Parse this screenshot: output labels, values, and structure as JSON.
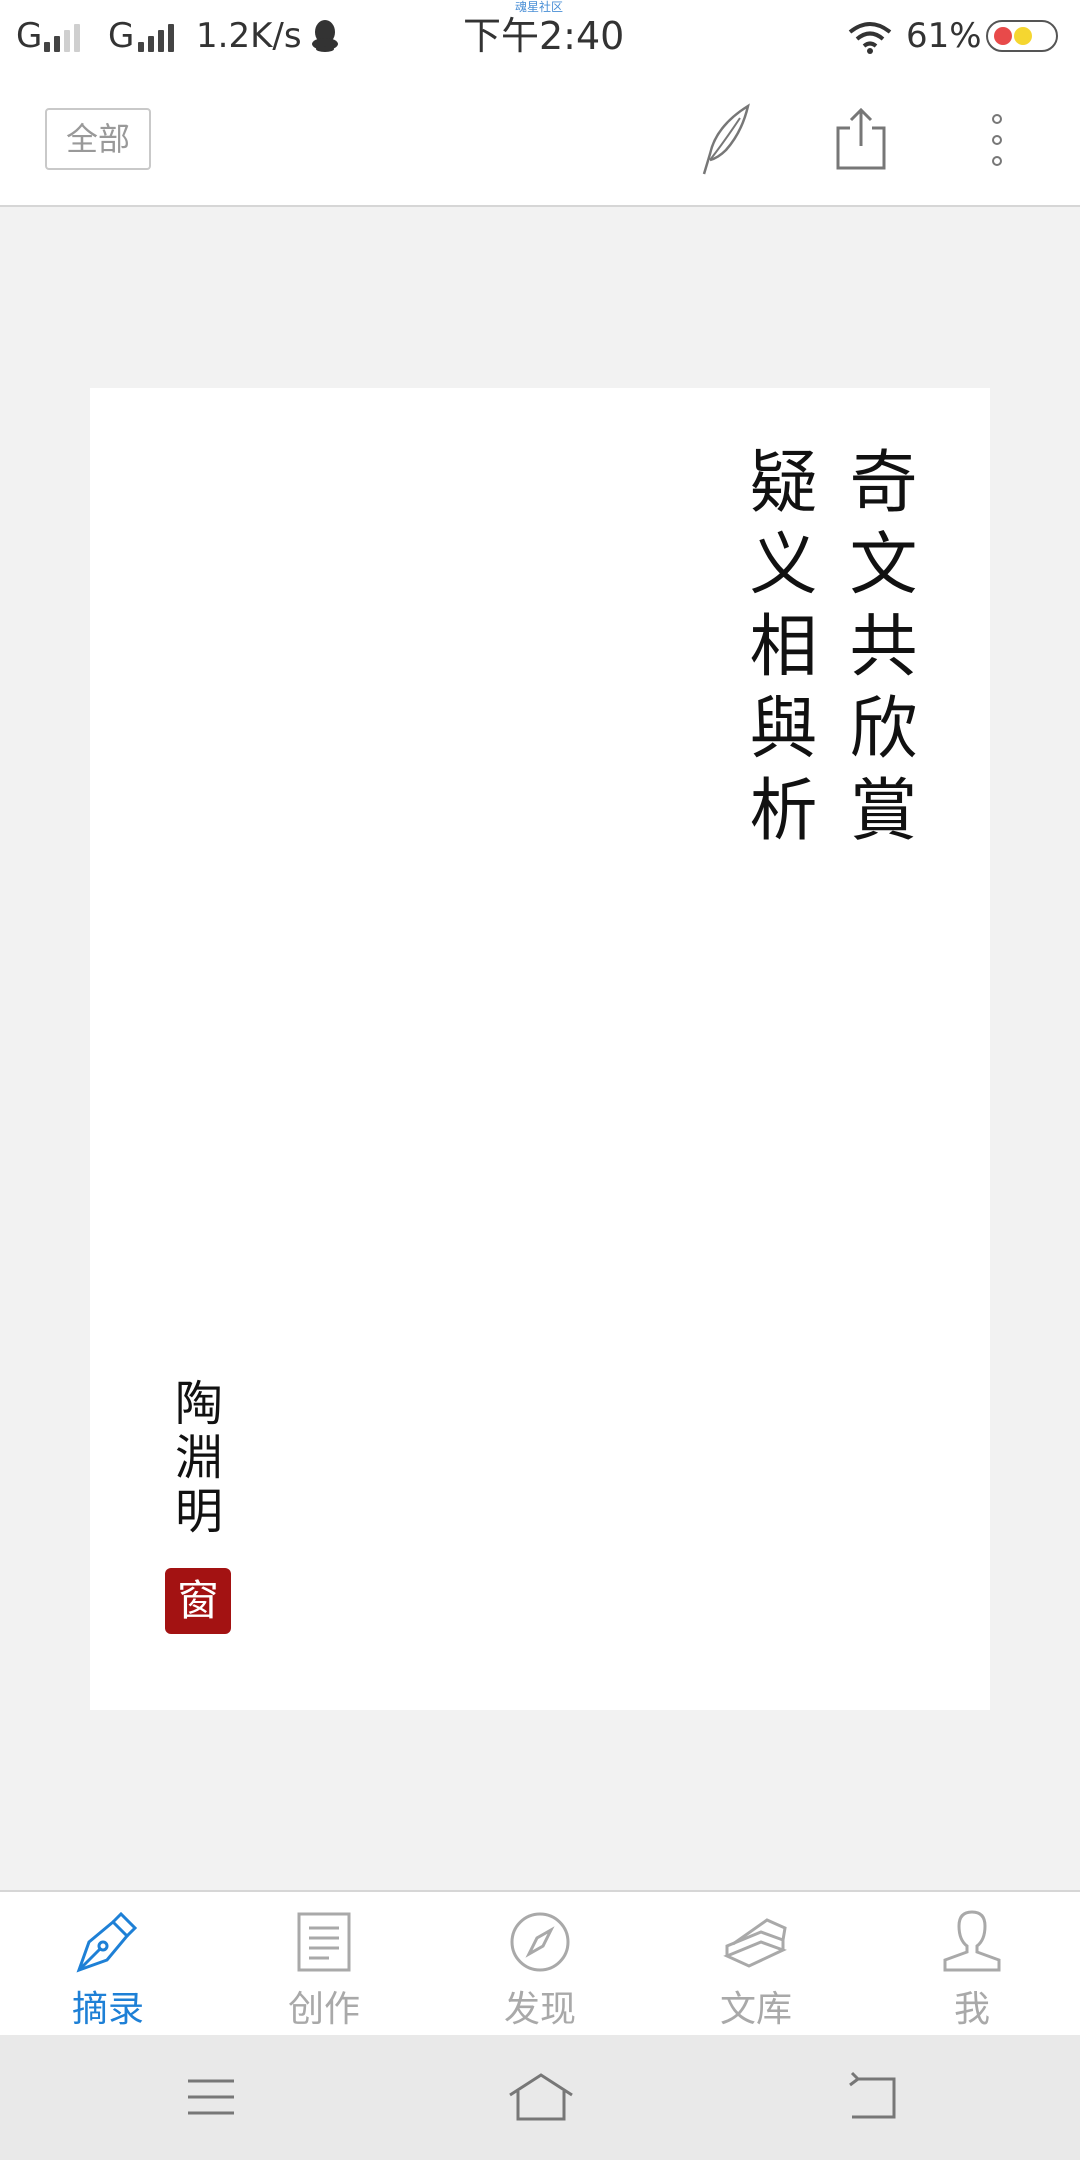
{
  "status_bar": {
    "carrier1": "G",
    "carrier2": "G",
    "speed": "1.2K/s",
    "time": "下午2:40",
    "community": "魂星社区",
    "battery": "61%",
    "icons": [
      "signal-icon",
      "qq-penguin-icon",
      "wifi-icon",
      "battery-icon"
    ]
  },
  "toolbar": {
    "filter_label": "全部",
    "icons": [
      "quill-icon",
      "share-icon",
      "more-icon"
    ]
  },
  "card": {
    "title_line1": "奇文共欣賞",
    "title_line2": "疑义相與析",
    "author": "陶淵明",
    "seal": "窗"
  },
  "nav": {
    "items": [
      {
        "label": "摘录",
        "icon": "fountain-pen-icon",
        "active": true
      },
      {
        "label": "创作",
        "icon": "document-icon",
        "active": false
      },
      {
        "label": "发现",
        "icon": "compass-icon",
        "active": false
      },
      {
        "label": "文库",
        "icon": "books-icon",
        "active": false
      },
      {
        "label": "我",
        "icon": "person-icon",
        "active": false
      }
    ]
  },
  "system_nav": {
    "icons": [
      "menu-icon",
      "home-icon",
      "back-icon"
    ]
  },
  "colors": {
    "accent": "#1e80d6",
    "seal": "#a31212",
    "background": "#f2f2f2"
  }
}
